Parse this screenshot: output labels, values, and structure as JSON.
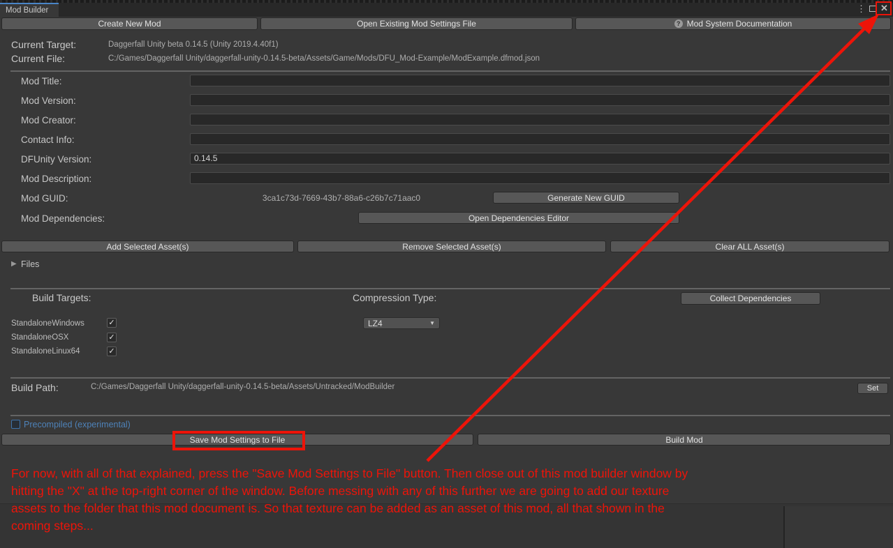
{
  "window": {
    "tab_title": "Mod Builder"
  },
  "icons": {
    "more": "⋮",
    "close": "✕",
    "help": "?",
    "check": "✓",
    "foldout_collapsed": "▶",
    "dropdown_arrow": "▼"
  },
  "colors": {
    "accent_blue": "#4a85c7",
    "link_blue": "#4e82b8",
    "annotation_red": "#ed1409"
  },
  "toolbar": {
    "create_new": "Create New Mod",
    "open_existing": "Open Existing Mod Settings File",
    "documentation": "Mod System Documentation"
  },
  "status": {
    "target_label": "Current Target:",
    "target_value": "Daggerfall Unity beta 0.14.5 (Unity 2019.4.40f1)",
    "file_label": "Current File:",
    "file_value": "C:/Games/Daggerfall Unity/daggerfall-unity-0.14.5-beta/Assets/Game/Mods/DFU_Mod-Example/ModExample.dfmod.json"
  },
  "form": {
    "fields": [
      {
        "label": "Mod Title:",
        "value": ""
      },
      {
        "label": "Mod Version:",
        "value": ""
      },
      {
        "label": "Mod Creator:",
        "value": ""
      },
      {
        "label": "Contact Info:",
        "value": ""
      },
      {
        "label": "DFUnity Version:",
        "value": "0.14.5"
      },
      {
        "label": "Mod Description:",
        "value": ""
      }
    ]
  },
  "guid": {
    "label": "Mod GUID:",
    "value": "3ca1c73d-7669-43b7-88a6-c26b7c71aac0",
    "generate_button": "Generate New GUID"
  },
  "dependencies": {
    "label": "Mod Dependencies:",
    "open_button": "Open Dependencies Editor"
  },
  "assets": {
    "add_button": "Add Selected Asset(s)",
    "remove_button": "Remove Selected Asset(s)",
    "clear_button": "Clear ALL Asset(s)",
    "files_foldout": "Files"
  },
  "build": {
    "targets_label": "Build Targets:",
    "compression_label": "Compression Type:",
    "collect_button": "Collect Dependencies",
    "targets": [
      {
        "name": "StandaloneWindows",
        "checked": true
      },
      {
        "name": "StandaloneOSX",
        "checked": true
      },
      {
        "name": "StandaloneLinux64",
        "checked": true
      }
    ],
    "compression_value": "LZ4"
  },
  "build_path": {
    "label": "Build Path:",
    "value": "C:/Games/Daggerfall Unity/daggerfall-unity-0.14.5-beta/Assets/Untracked/ModBuilder",
    "set_button": "Set"
  },
  "precompiled": {
    "label": "Precompiled (experimental)",
    "checked": false
  },
  "actions": {
    "save_button": "Save Mod Settings to File",
    "build_button": "Build Mod"
  },
  "annotation": {
    "lines": [
      "For now, with all of that explained, press the \"Save Mod Settings to File\" button. Then close out of this mod builder window by",
      "hitting the \"X\" at the top-right corner of the window. Before messing with any of this further we are going to add our texture",
      "assets to the folder that this mod document is. So that texture can be added as an asset of this mod, all that shown in the",
      "coming steps..."
    ]
  }
}
